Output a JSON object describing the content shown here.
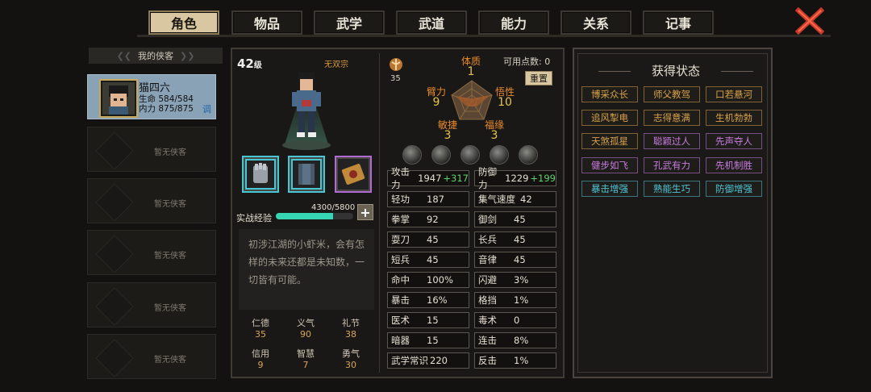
{
  "tabs": [
    {
      "label": "角色",
      "active": true
    },
    {
      "label": "物品"
    },
    {
      "label": "武学"
    },
    {
      "label": "武道"
    },
    {
      "label": "能力"
    },
    {
      "label": "关系"
    },
    {
      "label": "记事"
    }
  ],
  "party": {
    "header": "我的侠客",
    "selected": {
      "name": "猫四六",
      "hp_label": "生命 584/584",
      "mp_label": "内力 875/875",
      "tune": "调"
    },
    "empty_label": "暂无侠客"
  },
  "hero": {
    "level": "42",
    "level_suffix": "级",
    "sect": "无双宗",
    "exp_label": "实战经验",
    "exp_text": "4300/5800",
    "exp_fraction": 0.741,
    "description": "初涉江湖的小虾米，会有怎样的未来还都是未知数，一切皆有可能。",
    "virtues": [
      {
        "k": "仁德",
        "v": "35"
      },
      {
        "k": "义气",
        "v": "90"
      },
      {
        "k": "礼节",
        "v": "38"
      },
      {
        "k": "信用",
        "v": "9"
      },
      {
        "k": "智慧",
        "v": "7"
      },
      {
        "k": "勇气",
        "v": "30"
      }
    ]
  },
  "attributes": {
    "points_value": "35",
    "available_label": "可用点数: 0",
    "reset_label": "重置",
    "tizhi": {
      "k": "体质",
      "v": "1"
    },
    "bili": {
      "k": "臂力",
      "v": "9"
    },
    "wuxing": {
      "k": "悟性",
      "v": "10"
    },
    "minjie": {
      "k": "敏捷",
      "v": "3"
    },
    "fuyuan": {
      "k": "福缘",
      "v": "3"
    }
  },
  "stats": [
    {
      "k": "攻击力",
      "v": "1947",
      "plus": "+317"
    },
    {
      "k": "防御力",
      "v": "1229",
      "plus": "+199"
    },
    {
      "k": "轻功",
      "v": "187"
    },
    {
      "k": "集气速度",
      "v": "42"
    },
    {
      "k": "拳掌",
      "v": "92"
    },
    {
      "k": "御剑",
      "v": "45"
    },
    {
      "k": "耍刀",
      "v": "45"
    },
    {
      "k": "长兵",
      "v": "45"
    },
    {
      "k": "短兵",
      "v": "45"
    },
    {
      "k": "音律",
      "v": "45"
    },
    {
      "k": "命中",
      "v": "100%"
    },
    {
      "k": "闪避",
      "v": "3%"
    },
    {
      "k": "暴击",
      "v": "16%"
    },
    {
      "k": "格挡",
      "v": "1%"
    },
    {
      "k": "医术",
      "v": "15"
    },
    {
      "k": "毒术",
      "v": "0"
    },
    {
      "k": "暗器",
      "v": "15"
    },
    {
      "k": "连击",
      "v": "8%"
    },
    {
      "k": "武学常识",
      "v": "220"
    },
    {
      "k": "反击",
      "v": "1%"
    }
  ],
  "status": {
    "title": "获得状态",
    "badges": [
      {
        "label": "博采众长",
        "color": "#d8a24a"
      },
      {
        "label": "师父教驾",
        "color": "#d8a24a"
      },
      {
        "label": "口若悬河",
        "color": "#d8a24a"
      },
      {
        "label": "追风掣电",
        "color": "#d8a24a"
      },
      {
        "label": "志得意满",
        "color": "#d8a24a"
      },
      {
        "label": "生机勃勃",
        "color": "#d8a24a"
      },
      {
        "label": "天煞孤星",
        "color": "#d8a24a"
      },
      {
        "label": "聪颖过人",
        "color": "#c77ce0"
      },
      {
        "label": "先声夺人",
        "color": "#c77ce0"
      },
      {
        "label": "健步如飞",
        "color": "#c77ce0"
      },
      {
        "label": "孔武有力",
        "color": "#c77ce0"
      },
      {
        "label": "先机制胜",
        "color": "#c77ce0"
      },
      {
        "label": "暴击增强",
        "color": "#4fc6d6"
      },
      {
        "label": "熟能生巧",
        "color": "#4fc6d6"
      },
      {
        "label": "防御增强",
        "color": "#4fc6d6"
      }
    ]
  }
}
